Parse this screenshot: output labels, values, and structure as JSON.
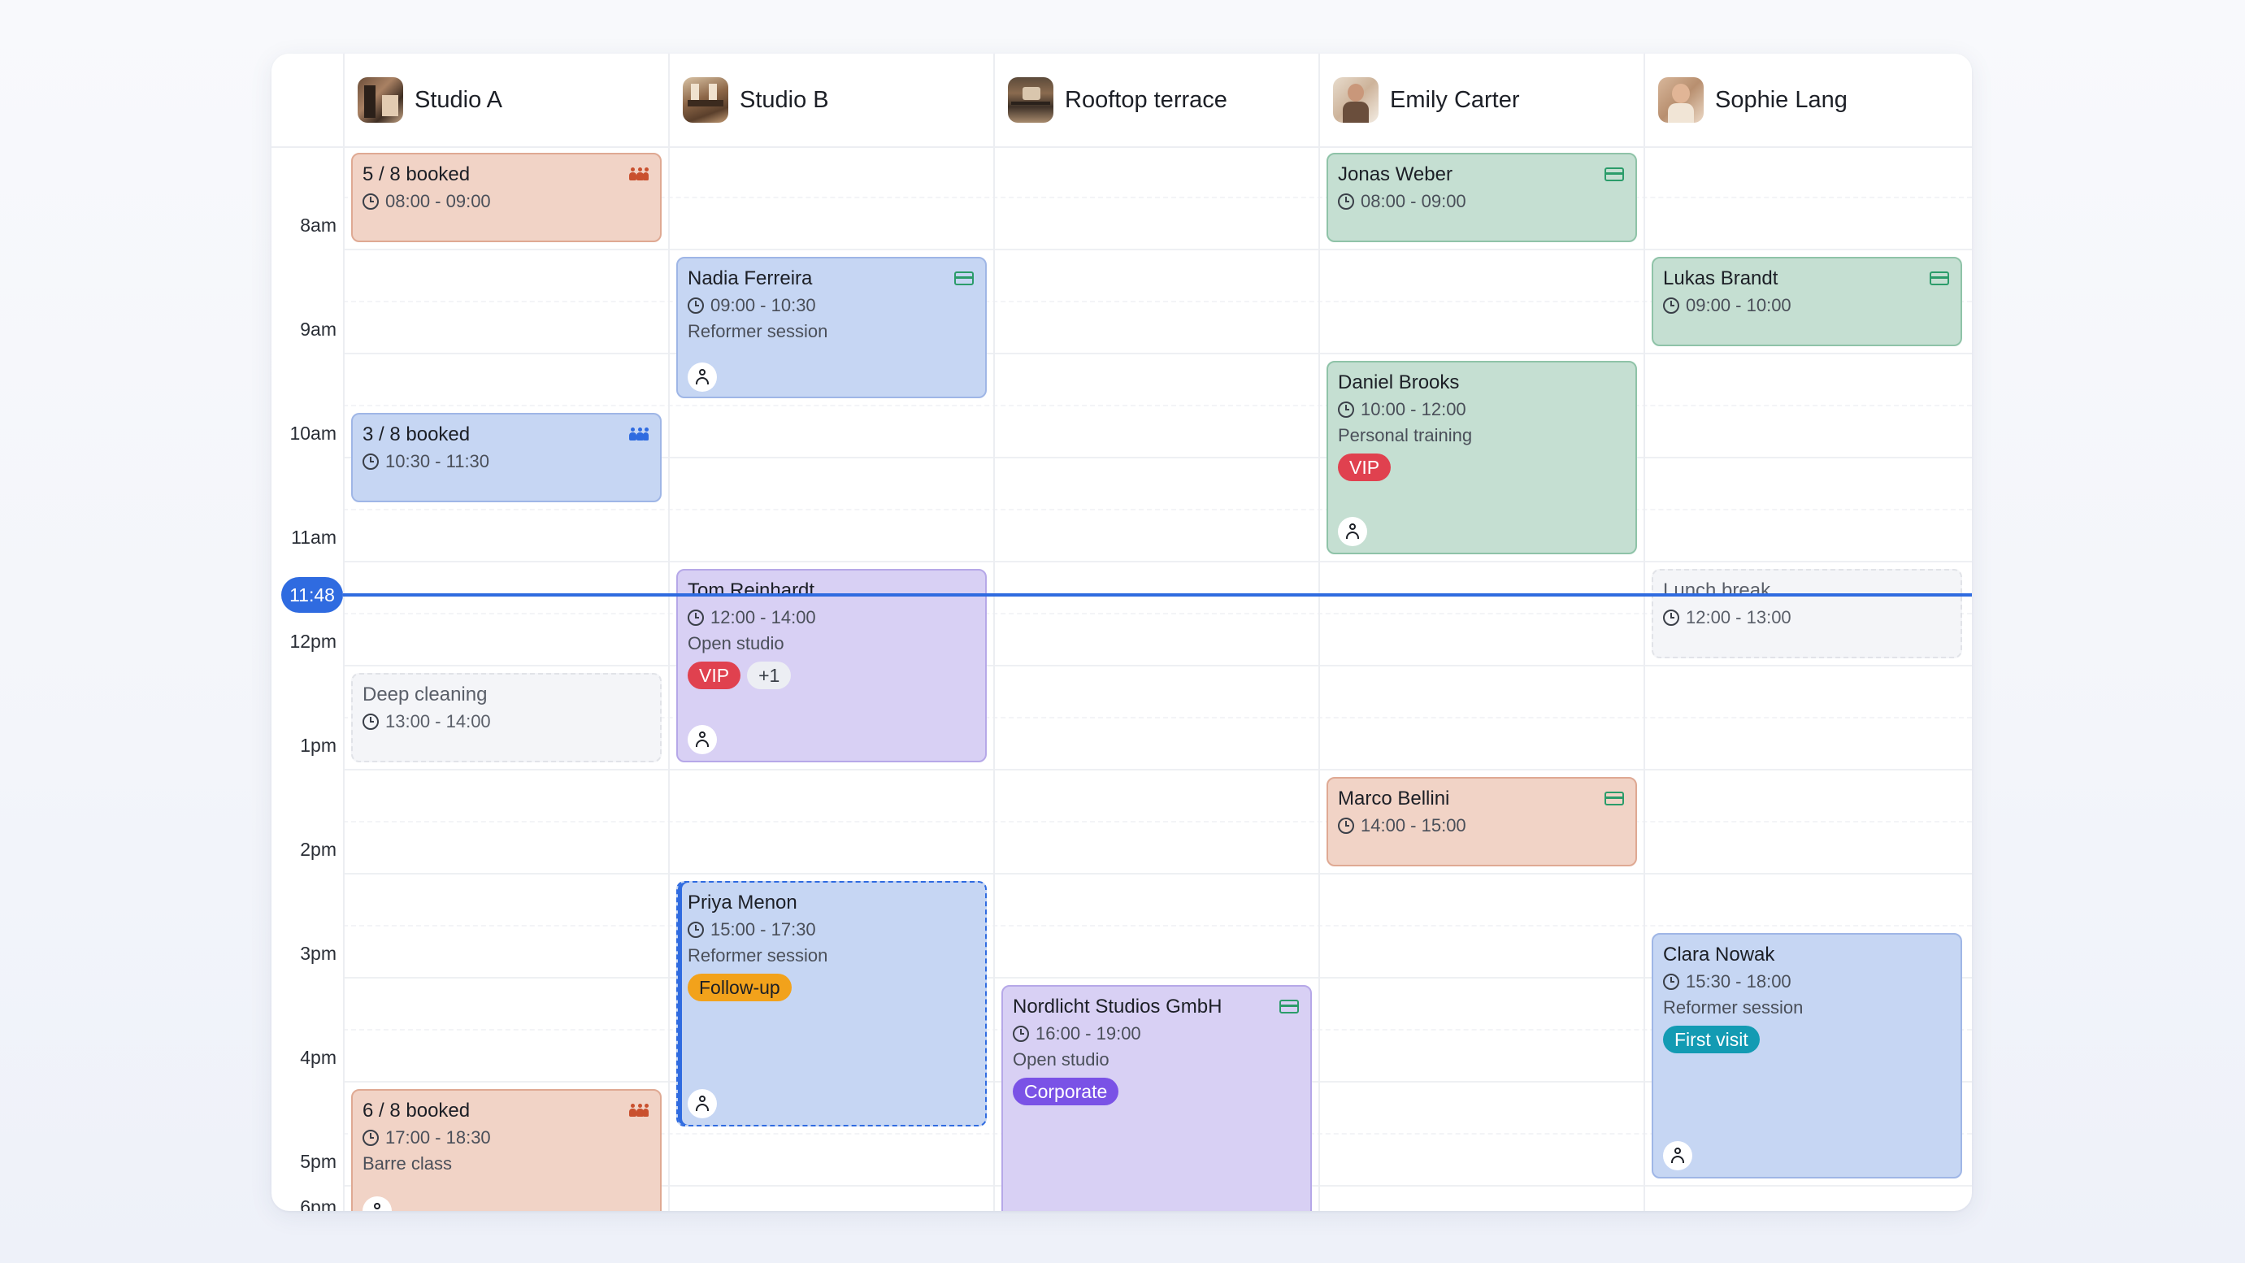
{
  "colors": {
    "accent": "#2f6be0",
    "vip": "#e0414f",
    "follow_up": "#f2a21b",
    "corporate": "#7a52e6",
    "first_visit": "#139bb3"
  },
  "resources": [
    {
      "name": "Studio A",
      "avatar": "studio-a-photo"
    },
    {
      "name": "Studio B",
      "avatar": "studio-b-photo"
    },
    {
      "name": "Rooftop terrace",
      "avatar": "rooftop-terrace-photo"
    },
    {
      "name": "Emily Carter",
      "avatar": "emily-carter-photo"
    },
    {
      "name": "Sophie Lang",
      "avatar": "sophie-lang-photo"
    }
  ],
  "time_labels": [
    "8am",
    "9am",
    "10am",
    "11am",
    "12pm",
    "1pm",
    "2pm",
    "3pm",
    "4pm",
    "5pm",
    "6pm"
  ],
  "now": "11:48",
  "events": [
    {
      "title": "5 / 8 booked",
      "time": "08:00 - 09:00",
      "icon": "group-icon"
    },
    {
      "title": "3 / 8 booked",
      "time": "10:30 - 11:30",
      "icon": "group-icon"
    },
    {
      "title": "Deep cleaning",
      "time": "13:00 - 14:00"
    },
    {
      "title": "6 / 8 booked",
      "time": "17:00 - 18:30",
      "desc": "Barre class",
      "icon": "group-icon"
    },
    {
      "title": "Nadia Ferreira",
      "time": "09:00 - 10:30",
      "desc": "Reformer session",
      "icon": "card-icon"
    },
    {
      "title": "Tom Reinhardt",
      "time": "12:00 - 14:00",
      "desc": "Open studio",
      "badges": [
        "VIP",
        "+1"
      ]
    },
    {
      "title": "Priya Menon",
      "time": "15:00 - 17:30",
      "desc": "Reformer session",
      "badges": [
        "Follow-up"
      ]
    },
    {
      "title": "Nordlicht Studios GmbH",
      "time": "16:00 - 19:00",
      "desc": "Open studio",
      "badges": [
        "Corporate"
      ],
      "icon": "card-icon"
    },
    {
      "title": "Jonas Weber",
      "time": "08:00 - 09:00",
      "icon": "card-icon"
    },
    {
      "title": "Daniel Brooks",
      "time": "10:00 - 12:00",
      "desc": "Personal training",
      "badges": [
        "VIP"
      ]
    },
    {
      "title": "Marco Bellini",
      "time": "14:00 - 15:00",
      "icon": "card-icon"
    },
    {
      "title": "Lukas Brandt",
      "time": "09:00 - 10:00",
      "icon": "card-icon"
    },
    {
      "title": "Lunch break",
      "time": "12:00 - 13:00"
    },
    {
      "title": "Clara Nowak",
      "time": "15:30 - 18:00",
      "desc": "Reformer session",
      "badges": [
        "First visit"
      ]
    }
  ]
}
